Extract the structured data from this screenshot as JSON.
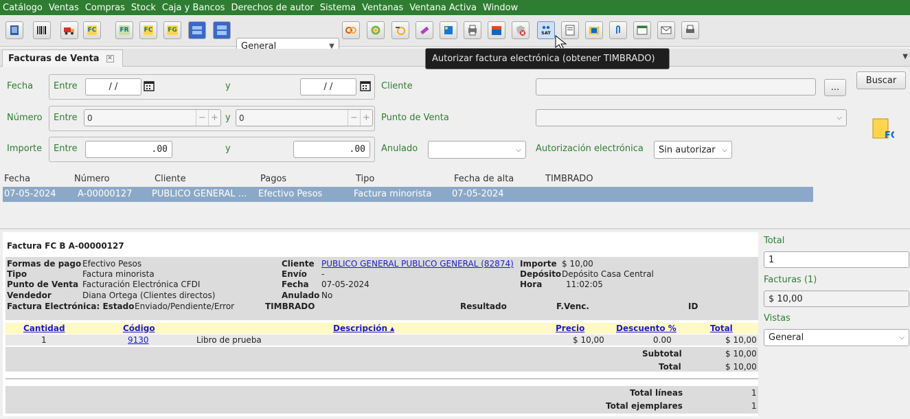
{
  "menu": [
    "Catálogo",
    "Ventas",
    "Compras",
    "Stock",
    "Caja y Bancos",
    "Derechos de autor",
    "Sistema",
    "Ventanas",
    "Ventana Activa",
    "Window"
  ],
  "toolbar": {
    "view_select": "General",
    "labels": {
      "fr": "FR",
      "fc": "FC",
      "fg": "FG",
      "fc2": "FC"
    },
    "tooltip": "Autorizar factura electrónica (obtener TIMBRADO)"
  },
  "tab": {
    "title": "Facturas de Venta"
  },
  "filters": {
    "fecha": {
      "label": "Fecha",
      "entre": "Entre",
      "y": "y",
      "from": "/ /",
      "to": "/ /"
    },
    "numero": {
      "label": "Número",
      "entre": "Entre",
      "y": "y",
      "from": "0",
      "to": "0"
    },
    "importe": {
      "label": "Importe",
      "entre": "Entre",
      "y": "y",
      "from": ".00",
      "to": ".00"
    },
    "cliente": {
      "label": "Cliente",
      "value": "",
      "browse": "..."
    },
    "punto_venta": {
      "label": "Punto de Venta",
      "value": ""
    },
    "anulado": {
      "label": "Anulado",
      "value": ""
    },
    "autorizacion": {
      "label": "Autorización electrónica",
      "value": "Sin autorizar"
    },
    "buscar": "Buscar"
  },
  "grid": {
    "columns": [
      "Fecha",
      "Número",
      "Cliente",
      "Pagos",
      "Tipo",
      "Fecha de alta",
      "TIMBRADO"
    ],
    "rows": [
      {
        "fecha": "07-05-2024",
        "numero": "A-00000127",
        "cliente": "PUBLICO GENERAL ...",
        "pagos": "Efectivo Pesos",
        "tipo": "Factura minorista",
        "alta": "07-05-2024",
        "timbrado": ""
      }
    ]
  },
  "detail": {
    "title": "Factura FC B A-00000127",
    "formas_label": "Formas de pago",
    "formas": "Efectivo Pesos",
    "tipo_label": "Tipo",
    "tipo": "Factura minorista",
    "pv_label": "Punto de Venta",
    "pv": "Facturación Electrónica CFDI",
    "vendedor_label": "Vendedor",
    "vendedor": "Diana Ortega (Clientes directos)",
    "fe_label": "Factura Electrónica: Estado",
    "fe": "Enviado/Pendiente/Error",
    "cliente_label": "Cliente",
    "cliente": "PUBLICO GENERAL PUBLICO GENERAL (82874)",
    "envio_label": "Envío",
    "envio": "-",
    "fecha_label": "Fecha",
    "fecha": "07-05-2024",
    "anulado_label": "Anulado",
    "anulado": "No",
    "timbrado_label": "TIMBRADO",
    "importe_label": "Importe",
    "importe": "$ 10,00",
    "deposito_label": "Depósito",
    "deposito": "Depósito Casa Central",
    "hora_label": "Hora",
    "hora": "11:02:05",
    "resultado_label": "Resultado",
    "fvenc_label": "F.Venc.",
    "id_label": "ID",
    "items_cols": {
      "cantidad": "Cantidad",
      "codigo": "Código",
      "descripcion": "Descripción ▴",
      "precio": "Precio",
      "descuento": "Descuento %",
      "total": "Total"
    },
    "items": [
      {
        "cantidad": "1",
        "codigo": "9130",
        "descripcion": "Libro de prueba",
        "precio": "$ 10,00",
        "descuento": "0.00",
        "total": "$ 10,00"
      }
    ],
    "subtotal_label": "Subtotal",
    "subtotal": "$ 10,00",
    "total_label": "Total",
    "total": "$ 10,00",
    "total_lineas_label": "Total líneas",
    "total_lineas": "1",
    "total_ejemplares_label": "Total ejemplares",
    "total_ejemplares": "1"
  },
  "sidebar": {
    "total_label": "Total",
    "total": "1",
    "facturas_label": "Facturas (1)",
    "facturas": "$ 10,00",
    "vistas_label": "Vistas",
    "vistas": "General"
  }
}
